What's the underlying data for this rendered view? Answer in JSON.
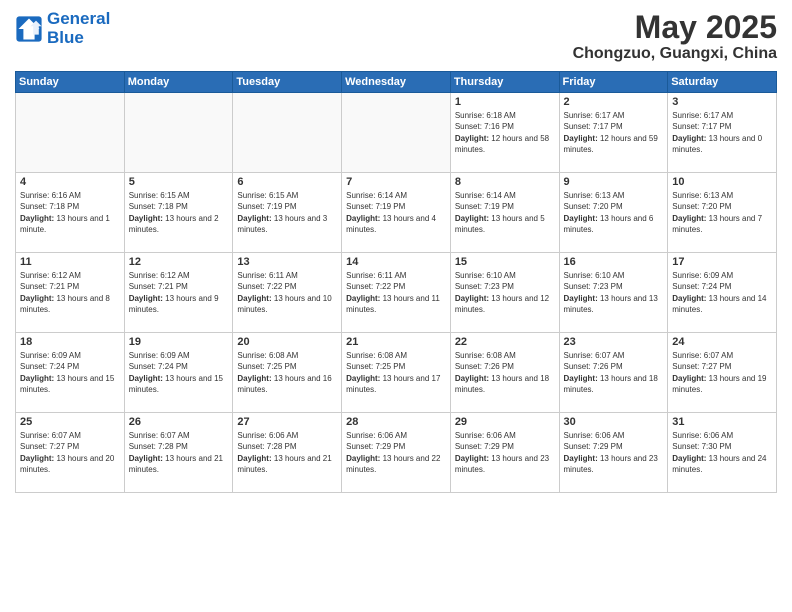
{
  "header": {
    "logo_line1": "General",
    "logo_line2": "Blue",
    "month": "May 2025",
    "location": "Chongzuo, Guangxi, China"
  },
  "weekdays": [
    "Sunday",
    "Monday",
    "Tuesday",
    "Wednesday",
    "Thursday",
    "Friday",
    "Saturday"
  ],
  "weeks": [
    [
      {
        "day": "",
        "info": ""
      },
      {
        "day": "",
        "info": ""
      },
      {
        "day": "",
        "info": ""
      },
      {
        "day": "",
        "info": ""
      },
      {
        "day": "1",
        "sunrise": "6:18 AM",
        "sunset": "7:16 PM",
        "daylight": "12 hours and 58 minutes."
      },
      {
        "day": "2",
        "sunrise": "6:17 AM",
        "sunset": "7:17 PM",
        "daylight": "12 hours and 59 minutes."
      },
      {
        "day": "3",
        "sunrise": "6:17 AM",
        "sunset": "7:17 PM",
        "daylight": "13 hours and 0 minutes."
      }
    ],
    [
      {
        "day": "4",
        "sunrise": "6:16 AM",
        "sunset": "7:18 PM",
        "daylight": "13 hours and 1 minute."
      },
      {
        "day": "5",
        "sunrise": "6:15 AM",
        "sunset": "7:18 PM",
        "daylight": "13 hours and 2 minutes."
      },
      {
        "day": "6",
        "sunrise": "6:15 AM",
        "sunset": "7:19 PM",
        "daylight": "13 hours and 3 minutes."
      },
      {
        "day": "7",
        "sunrise": "6:14 AM",
        "sunset": "7:19 PM",
        "daylight": "13 hours and 4 minutes."
      },
      {
        "day": "8",
        "sunrise": "6:14 AM",
        "sunset": "7:19 PM",
        "daylight": "13 hours and 5 minutes."
      },
      {
        "day": "9",
        "sunrise": "6:13 AM",
        "sunset": "7:20 PM",
        "daylight": "13 hours and 6 minutes."
      },
      {
        "day": "10",
        "sunrise": "6:13 AM",
        "sunset": "7:20 PM",
        "daylight": "13 hours and 7 minutes."
      }
    ],
    [
      {
        "day": "11",
        "sunrise": "6:12 AM",
        "sunset": "7:21 PM",
        "daylight": "13 hours and 8 minutes."
      },
      {
        "day": "12",
        "sunrise": "6:12 AM",
        "sunset": "7:21 PM",
        "daylight": "13 hours and 9 minutes."
      },
      {
        "day": "13",
        "sunrise": "6:11 AM",
        "sunset": "7:22 PM",
        "daylight": "13 hours and 10 minutes."
      },
      {
        "day": "14",
        "sunrise": "6:11 AM",
        "sunset": "7:22 PM",
        "daylight": "13 hours and 11 minutes."
      },
      {
        "day": "15",
        "sunrise": "6:10 AM",
        "sunset": "7:23 PM",
        "daylight": "13 hours and 12 minutes."
      },
      {
        "day": "16",
        "sunrise": "6:10 AM",
        "sunset": "7:23 PM",
        "daylight": "13 hours and 13 minutes."
      },
      {
        "day": "17",
        "sunrise": "6:09 AM",
        "sunset": "7:24 PM",
        "daylight": "13 hours and 14 minutes."
      }
    ],
    [
      {
        "day": "18",
        "sunrise": "6:09 AM",
        "sunset": "7:24 PM",
        "daylight": "13 hours and 15 minutes."
      },
      {
        "day": "19",
        "sunrise": "6:09 AM",
        "sunset": "7:24 PM",
        "daylight": "13 hours and 15 minutes."
      },
      {
        "day": "20",
        "sunrise": "6:08 AM",
        "sunset": "7:25 PM",
        "daylight": "13 hours and 16 minutes."
      },
      {
        "day": "21",
        "sunrise": "6:08 AM",
        "sunset": "7:25 PM",
        "daylight": "13 hours and 17 minutes."
      },
      {
        "day": "22",
        "sunrise": "6:08 AM",
        "sunset": "7:26 PM",
        "daylight": "13 hours and 18 minutes."
      },
      {
        "day": "23",
        "sunrise": "6:07 AM",
        "sunset": "7:26 PM",
        "daylight": "13 hours and 18 minutes."
      },
      {
        "day": "24",
        "sunrise": "6:07 AM",
        "sunset": "7:27 PM",
        "daylight": "13 hours and 19 minutes."
      }
    ],
    [
      {
        "day": "25",
        "sunrise": "6:07 AM",
        "sunset": "7:27 PM",
        "daylight": "13 hours and 20 minutes."
      },
      {
        "day": "26",
        "sunrise": "6:07 AM",
        "sunset": "7:28 PM",
        "daylight": "13 hours and 21 minutes."
      },
      {
        "day": "27",
        "sunrise": "6:06 AM",
        "sunset": "7:28 PM",
        "daylight": "13 hours and 21 minutes."
      },
      {
        "day": "28",
        "sunrise": "6:06 AM",
        "sunset": "7:29 PM",
        "daylight": "13 hours and 22 minutes."
      },
      {
        "day": "29",
        "sunrise": "6:06 AM",
        "sunset": "7:29 PM",
        "daylight": "13 hours and 23 minutes."
      },
      {
        "day": "30",
        "sunrise": "6:06 AM",
        "sunset": "7:29 PM",
        "daylight": "13 hours and 23 minutes."
      },
      {
        "day": "31",
        "sunrise": "6:06 AM",
        "sunset": "7:30 PM",
        "daylight": "13 hours and 24 minutes."
      }
    ]
  ]
}
